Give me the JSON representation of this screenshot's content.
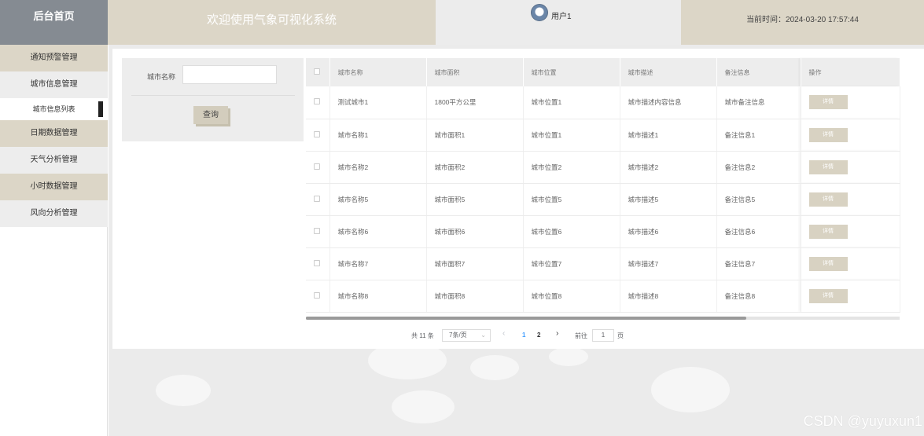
{
  "header": {
    "brand": "后台首页",
    "welcome": "欢迎使用气象可视化系统",
    "username": "用户1",
    "time_label": "当前时间：2024-03-20 17:57:44"
  },
  "sidebar": {
    "items": [
      {
        "label": "通知预警管理"
      },
      {
        "label": "城市信息管理"
      },
      {
        "label": "城市信息列表"
      },
      {
        "label": "日期数据管理"
      },
      {
        "label": "天气分析管理"
      },
      {
        "label": "小时数据管理"
      },
      {
        "label": "风向分析管理"
      }
    ]
  },
  "search": {
    "label": "城市名称",
    "value": "",
    "button": "查询"
  },
  "table": {
    "columns": [
      "城市名称",
      "城市面积",
      "城市位置",
      "城市描述",
      "备注信息",
      "操作"
    ],
    "detail_label": "详情",
    "rows": [
      [
        "测试城市1",
        "1800平方公里",
        "城市位置1",
        "城市描述内容信息",
        "城市备注信息"
      ],
      [
        "城市名称1",
        "城市面积1",
        "城市位置1",
        "城市描述1",
        "备注信息1"
      ],
      [
        "城市名称2",
        "城市面积2",
        "城市位置2",
        "城市描述2",
        "备注信息2"
      ],
      [
        "城市名称5",
        "城市面积5",
        "城市位置5",
        "城市描述5",
        "备注信息5"
      ],
      [
        "城市名称6",
        "城市面积6",
        "城市位置6",
        "城市描述6",
        "备注信息6"
      ],
      [
        "城市名称7",
        "城市面积7",
        "城市位置7",
        "城市描述7",
        "备注信息7"
      ],
      [
        "城市名称8",
        "城市面积8",
        "城市位置8",
        "城市描述8",
        "备注信息8"
      ]
    ]
  },
  "pagination": {
    "total": "共 11 条",
    "page_size": "7条/页",
    "prev": "‹",
    "pages": [
      "1",
      "2"
    ],
    "next": "›",
    "goto_prefix": "前往",
    "goto_value": "1",
    "goto_suffix": "页"
  },
  "colors": {
    "accent": "#dcd6c7",
    "brand_bg": "#858b92",
    "active_page": "#409eff"
  },
  "watermark": "CSDN @yuyuxun1"
}
